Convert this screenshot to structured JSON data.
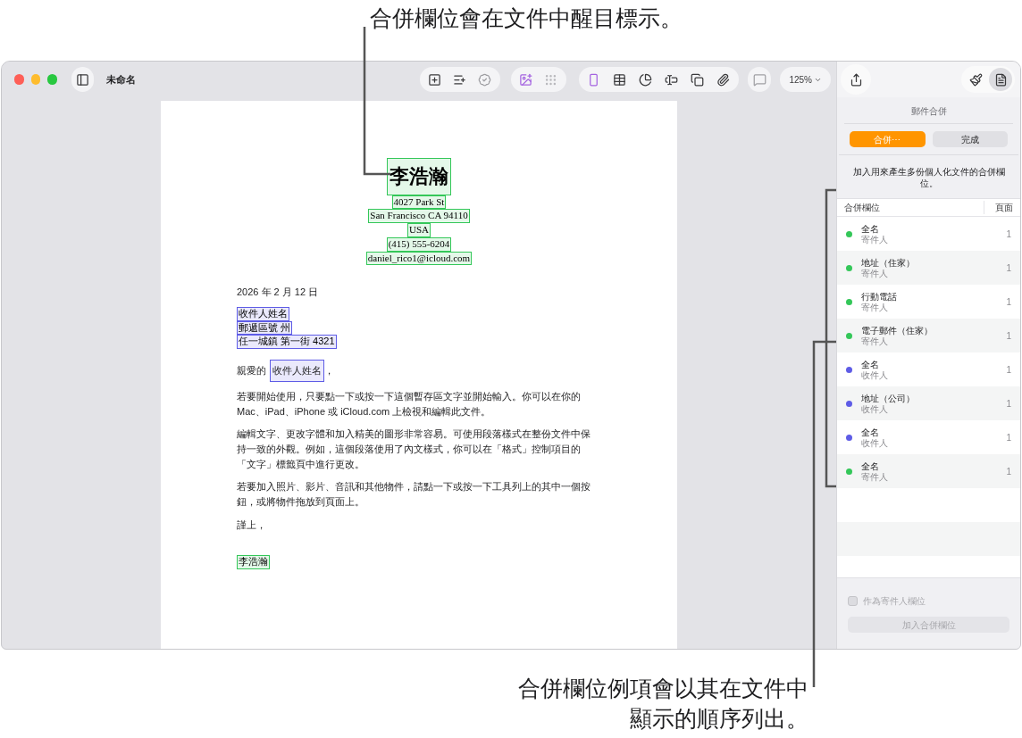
{
  "callouts": [
    {
      "kind": "top",
      "text": "合併欄位會在文件中醒目標示。"
    },
    {
      "kind": "bottom",
      "text": "合併欄位例項會以其在文件中顯示的順序列出。"
    }
  ],
  "window": {
    "title": "未命名",
    "zoom": "125%"
  },
  "document": {
    "sender_fields": [
      {
        "kind": "name",
        "text": "李浩瀚",
        "color": "#34c759"
      },
      {
        "kind": "line",
        "text": "4027 Park St",
        "color": "#34c759"
      },
      {
        "kind": "line",
        "text": "San Francisco CA 94110",
        "color": "#34c759"
      },
      {
        "kind": "line",
        "text": "USA",
        "color": "#34c759"
      },
      {
        "kind": "line",
        "text": "(415) 555-6204",
        "color": "#34c759"
      },
      {
        "kind": "line",
        "text": "daniel_rico1@icloud.com",
        "color": "#34c759"
      }
    ],
    "date": "2026 年 2 月 12 日",
    "recipient_fields": [
      {
        "text": "收件人姓名",
        "color": "#5e5ce6"
      },
      {
        "text": "郵遞區號 州",
        "color": "#5e5ce6"
      },
      {
        "text": "任一城鎮 第一街 4321",
        "color": "#5e5ce6"
      }
    ],
    "greeting": {
      "before": "親愛的",
      "field": {
        "text": "收件人姓名",
        "color": "#5e5ce6"
      },
      "after": "，"
    },
    "paragraphs": [
      "若要開始使用，只要點一下或按一下這個暫存區文字並開始輸入。你可以在你的 Mac、iPad、iPhone 或 iCloud.com 上檢視和編輯此文件。",
      "編輯文字、更改字體和加入精美的圖形非常容易。可使用段落樣式在整份文件中保持一致的外觀。例如，這個段落使用了內文樣式，你可以在「格式」控制項目的「文字」標籤頁中進行更改。",
      "若要加入照片、影片、音訊和其他物件，請點一下或按一下工具列上的其中一個按鈕，或將物件拖放到頁面上。"
    ],
    "closing": "謹上，",
    "signature": {
      "text": "李浩瀚",
      "color": "#34c759"
    }
  },
  "sidebar": {
    "title": "郵件合併",
    "buttons": [
      {
        "label": "合併⋯",
        "selected": true
      },
      {
        "label": "完成",
        "selected": false
      }
    ],
    "description": "加入用來產生多份個人化文件的合併欄位。",
    "columns": [
      "合併欄位",
      "頁面"
    ],
    "fields": [
      {
        "name": "全名",
        "source": "寄件人",
        "page": "1",
        "color": "#34c759"
      },
      {
        "name": "地址（住家）",
        "source": "寄件人",
        "page": "1",
        "color": "#34c759"
      },
      {
        "name": "行動電話",
        "source": "寄件人",
        "page": "1",
        "color": "#34c759"
      },
      {
        "name": "電子郵件（住家）",
        "source": "寄件人",
        "page": "1",
        "color": "#34c759"
      },
      {
        "name": "全名",
        "source": "收件人",
        "page": "1",
        "color": "#5e5ce6"
      },
      {
        "name": "地址（公司）",
        "source": "收件人",
        "page": "1",
        "color": "#5e5ce6"
      },
      {
        "name": "全名",
        "source": "收件人",
        "page": "1",
        "color": "#5e5ce6"
      },
      {
        "name": "全名",
        "source": "寄件人",
        "page": "1",
        "color": "#34c759"
      }
    ],
    "sender_checkbox": {
      "label": "作為寄件人欄位",
      "checked": false,
      "disabled": true
    },
    "add_button": {
      "label": "加入合併欄位",
      "disabled": true
    }
  }
}
